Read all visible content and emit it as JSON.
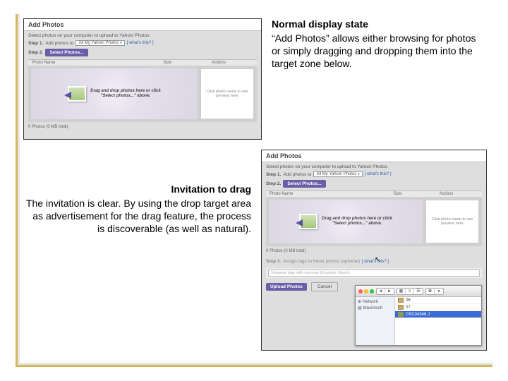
{
  "section1": {
    "heading": "Normal display state",
    "body": "“Add Photos” allows either browsing for photos or simply dragging and dropping them into the target zone below."
  },
  "section2": {
    "heading": "Invitation to drag",
    "body": "The invitation is clear. By using the drop target area as advertisement for the drag feature, the process is discoverable (as well as natural)."
  },
  "app": {
    "title": "Add Photos",
    "instr": "Select photos on your computer to upload to Yahoo! Photos.",
    "step1_label": "Step 1.",
    "step1_text": "Add photos to",
    "album_dd": "All My Yahoo! Photos",
    "whats_this": "[ what's this? ]",
    "step2_label": "Step 2.",
    "select_btn": "Select Photos...",
    "cols": {
      "name": "Photo Name",
      "size": "Size",
      "actions": "Actions"
    },
    "dz_line1": "Drag and drop photos here or click",
    "dz_line2": "\"Select photos...\" above.",
    "sidebox": "Click photo name to see preview here",
    "footer_count": "0 Photos (0 MB total)",
    "step3_label": "Step 3.",
    "step3_text": "Assign tags to these photos (optional)",
    "tag_placeholder": "Separate tags with commas (Example: Mya's)",
    "upload_btn": "Upload Photos",
    "cancel_btn": "Cancel"
  },
  "finder": {
    "side": {
      "network": "Network",
      "mac": "Macintosh"
    },
    "rows": [
      {
        "name": "06",
        "sel": false
      },
      {
        "name": "07",
        "sel": false
      },
      {
        "name": "DSC04346.J",
        "sel": true
      }
    ]
  }
}
